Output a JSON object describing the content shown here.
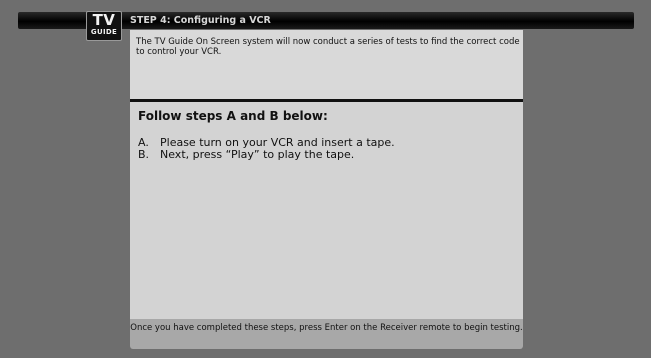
{
  "header": {
    "logo_top": "TV",
    "logo_bottom": "GUIDE",
    "title": "STEP 4: Configuring a VCR"
  },
  "intro": {
    "text": "The TV Guide On Screen system will now conduct a series of tests to find the correct code to control your VCR."
  },
  "main": {
    "heading": "Follow steps A and B below:",
    "steps": [
      {
        "letter": "A.",
        "text": "Please turn on your VCR and insert a tape."
      },
      {
        "letter": "B.",
        "text": "Next, press “Play” to play the tape."
      }
    ]
  },
  "footer": {
    "text": "Once you have completed these steps, press Enter on the Receiver remote to begin testing."
  },
  "colors": {
    "background": "#6e6e6e",
    "title_bar": "#000000",
    "intro_panel": "#d9d9d9",
    "main_panel": "#d3d3d3",
    "footer_panel": "#a8a8a8"
  }
}
